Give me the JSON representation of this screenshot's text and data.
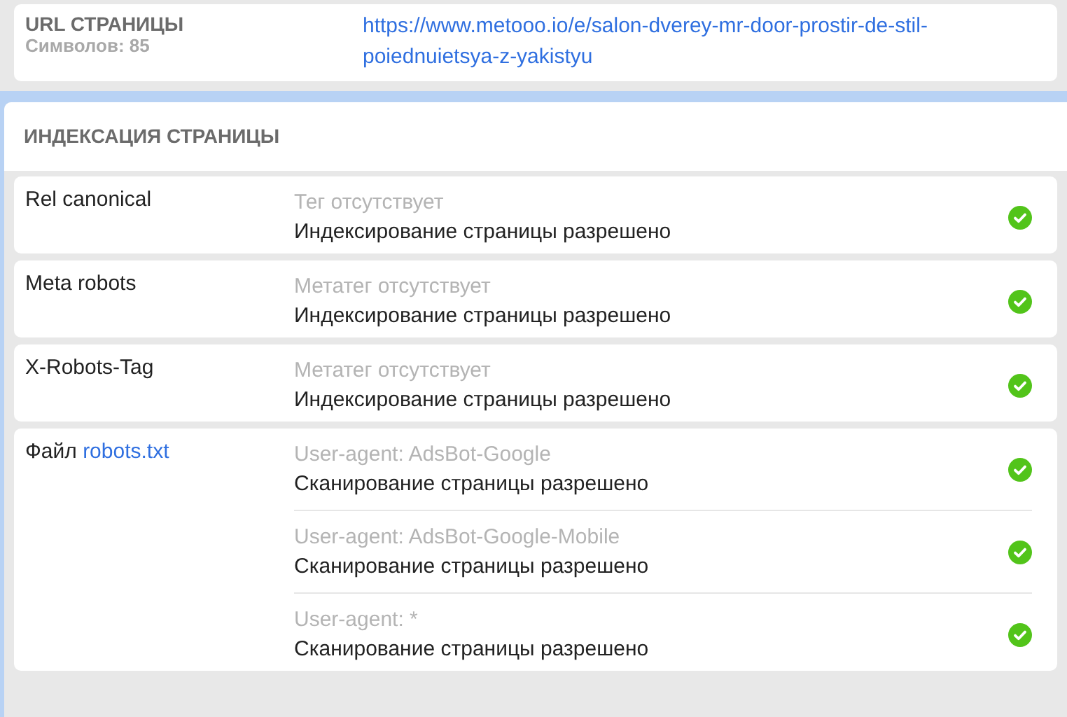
{
  "url_section": {
    "label": "URL СТРАНИЦЫ",
    "count": "Символов: 85",
    "value": "https://www.metooo.io/e/salon-dverey-mr-door-prostir-de-stil-poiednuietsya-z-yakistyu"
  },
  "indexing": {
    "title": "ИНДЕКСАЦИЯ СТРАНИЦЫ",
    "rows": [
      {
        "label": "Rel canonical",
        "checks": [
          {
            "note": "Тег отсутствует",
            "result": "Индексирование страницы разрешено",
            "passed": true
          }
        ]
      },
      {
        "label": "Meta robots",
        "checks": [
          {
            "note": "Метатег отсутствует",
            "result": "Индексирование страницы разрешено",
            "passed": true
          }
        ]
      },
      {
        "label": "X-Robots-Tag",
        "checks": [
          {
            "note": "Метатег отсутствует",
            "result": "Индексирование страницы разрешено",
            "passed": true
          }
        ]
      },
      {
        "label": "Файл",
        "link": "robots.txt",
        "checks": [
          {
            "note": "User-agent: AdsBot-Google",
            "result": "Сканирование страницы разрешено",
            "passed": true
          },
          {
            "note": "User-agent: AdsBot-Google-Mobile",
            "result": "Сканирование страницы разрешено",
            "passed": true
          },
          {
            "note": "User-agent: *",
            "result": "Сканирование страницы разрешено",
            "passed": true
          }
        ]
      }
    ]
  }
}
